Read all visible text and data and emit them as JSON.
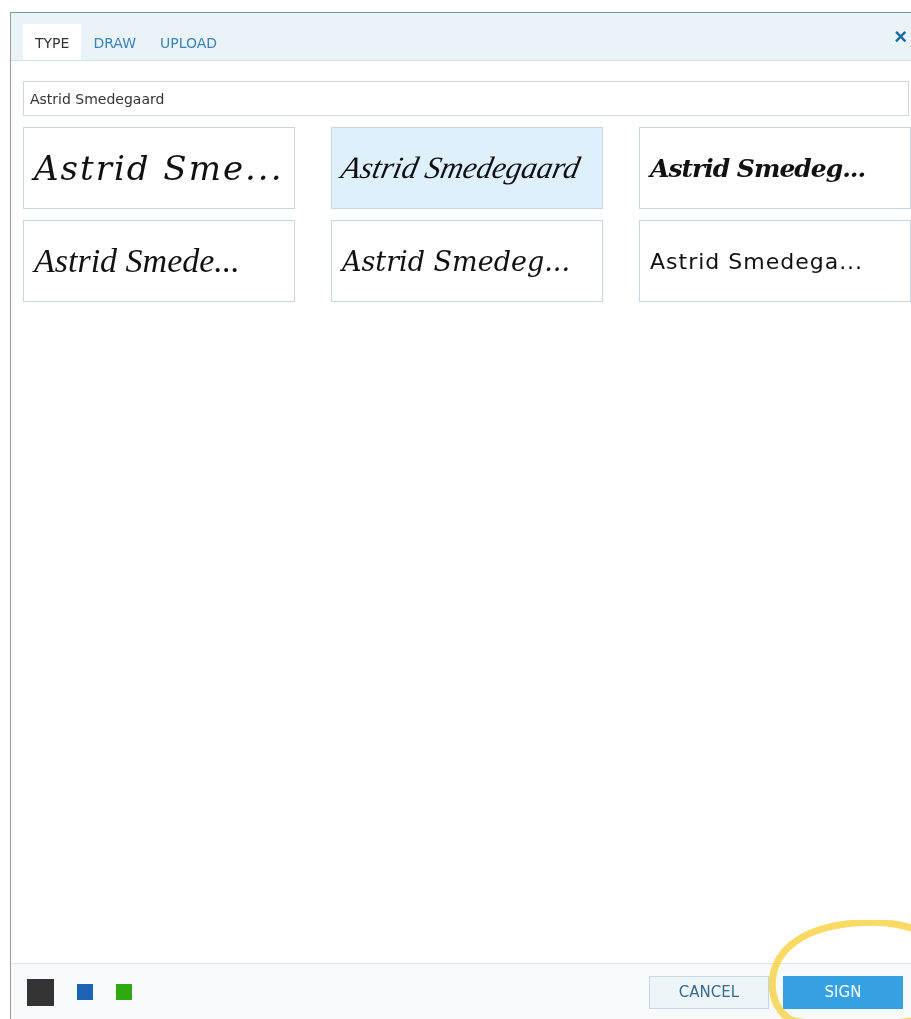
{
  "tabs": [
    {
      "label": "TYPE",
      "selected": true
    },
    {
      "label": "DRAW",
      "selected": false
    },
    {
      "label": "UPLOAD",
      "selected": false
    }
  ],
  "close": "×",
  "name_field": {
    "value": "Astrid Smedegaard"
  },
  "signatures": [
    {
      "text": "Astrid Sme...",
      "selected": false
    },
    {
      "text": "Astrid Smedegaard",
      "selected": true
    },
    {
      "text": "Astrid Smedeg...",
      "selected": false
    },
    {
      "text": "Astrid Smede...",
      "selected": false
    },
    {
      "text": "Astrid Smedeg...",
      "selected": false
    },
    {
      "text": "Astrid Smedega...",
      "selected": false
    }
  ],
  "colors": [
    {
      "color": "#333333",
      "selected": true
    },
    {
      "color": "#1a63b5",
      "selected": false
    },
    {
      "color": "#2eaa10",
      "selected": false
    }
  ],
  "buttons": [
    {
      "label": "CANCEL",
      "kind": "secondary"
    },
    {
      "label": "SIGN",
      "kind": "primary"
    }
  ],
  "annotation": {
    "kind": "circle"
  }
}
